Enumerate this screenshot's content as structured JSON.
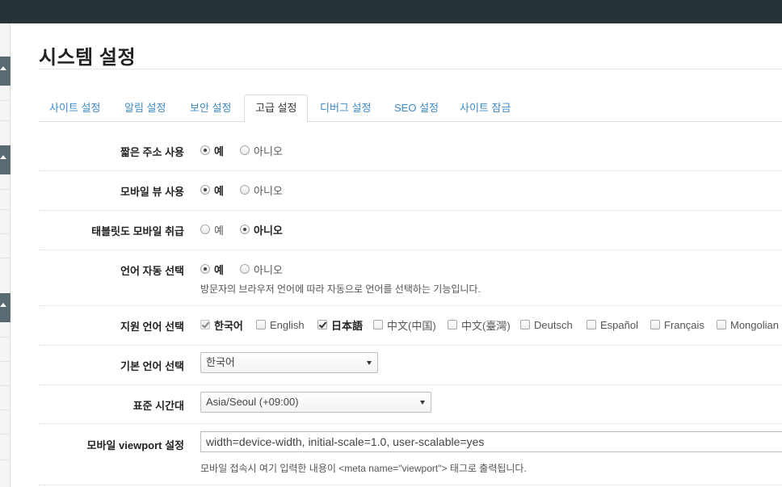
{
  "page": {
    "title": "시스템 설정"
  },
  "tabs": [
    {
      "label": "사이트 설정",
      "active": false
    },
    {
      "label": "알림 설정",
      "active": false
    },
    {
      "label": "보안 설정",
      "active": false
    },
    {
      "label": "고급 설정",
      "active": true
    },
    {
      "label": "디버그 설정",
      "active": false
    },
    {
      "label": "SEO 설정",
      "active": false
    },
    {
      "label": "사이트 잠금",
      "active": false
    }
  ],
  "settings": {
    "short_url": {
      "label": "짧은 주소 사용",
      "yes": "예",
      "no": "아니오",
      "selected": "yes"
    },
    "mobile_view": {
      "label": "모바일 뷰 사용",
      "yes": "예",
      "no": "아니오",
      "selected": "yes"
    },
    "tablet_mobile": {
      "label": "태블릿도 모바일 취급",
      "yes": "예",
      "no": "아니오",
      "selected": "no"
    },
    "auto_lang": {
      "label": "언어 자동 선택",
      "yes": "예",
      "no": "아니오",
      "selected": "yes",
      "help": "방문자의 브라우저 언어에 따라 자동으로 언어를 선택하는 기능입니다."
    },
    "supported_langs": {
      "label": "지원 언어 선택",
      "options": [
        {
          "label": "한국어",
          "checked": true,
          "disabled": true
        },
        {
          "label": "English",
          "checked": false,
          "disabled": false
        },
        {
          "label": "日本語",
          "checked": true,
          "disabled": false
        },
        {
          "label": "中文(中国)",
          "checked": false,
          "disabled": false
        },
        {
          "label": "中文(臺灣)",
          "checked": false,
          "disabled": false
        },
        {
          "label": "Deutsch",
          "checked": false,
          "disabled": false
        },
        {
          "label": "Español",
          "checked": false,
          "disabled": false
        },
        {
          "label": "Français",
          "checked": false,
          "disabled": false
        },
        {
          "label": "Mongolian",
          "checked": false,
          "disabled": false
        }
      ]
    },
    "default_lang": {
      "label": "기본 언어 선택",
      "value": "한국어"
    },
    "timezone": {
      "label": "표준 시간대",
      "value": "Asia/Seoul (+09:00)"
    },
    "viewport": {
      "label": "모바일 viewport 설정",
      "value": "width=device-width, initial-scale=1.0, user-scalable=yes",
      "help": "모바일 접속시 여기 입력한 내용이 <meta name=\"viewport\"> 태그로 출력됩니다."
    }
  },
  "colors": {
    "topbar": "#283339",
    "sidebar_block": "#5a6a72",
    "tab_link": "#3c8ac9"
  },
  "icons": {
    "sidebar_toggle": "caret-up-icon",
    "select_arrow": "caret-down-icon"
  }
}
